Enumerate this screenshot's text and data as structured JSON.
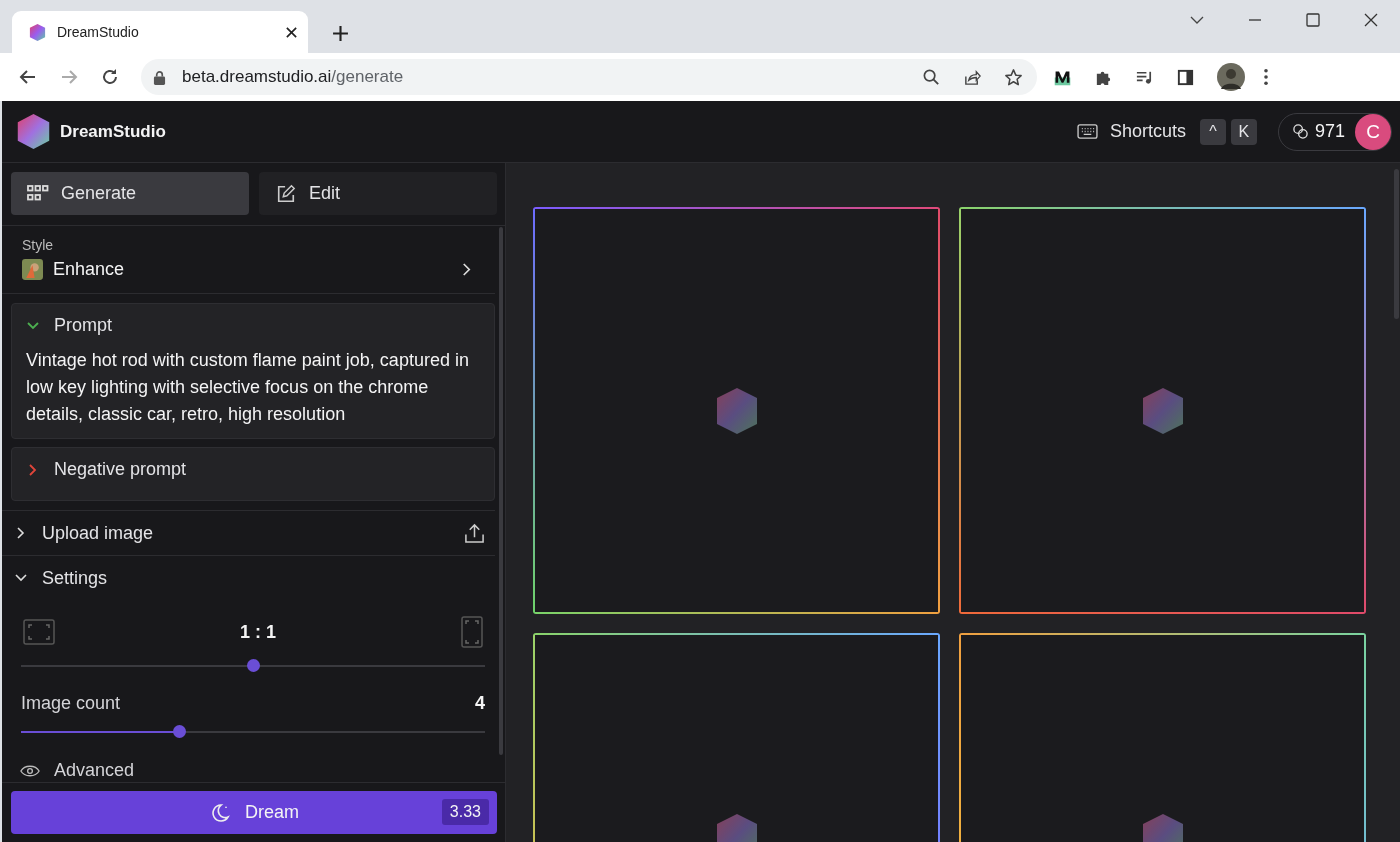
{
  "browser": {
    "tab_title": "DreamStudio",
    "url_host": "beta.dreamstudio.ai",
    "url_path": "/generate"
  },
  "header": {
    "app_name": "DreamStudio",
    "shortcuts_label": "Shortcuts",
    "keys": [
      "^",
      "K"
    ],
    "credits": "971",
    "user_initial": "C"
  },
  "mode_tabs": [
    {
      "label": "Generate",
      "selected": true,
      "kind": "grid"
    },
    {
      "label": "Edit",
      "selected": false,
      "kind": "edit"
    }
  ],
  "style": {
    "label": "Style",
    "value": "Enhance"
  },
  "prompts": [
    {
      "title": "Prompt",
      "expanded": true,
      "color": "#4caf50",
      "text": "Vintage hot rod with custom flame paint job, captured in low key lighting with selective focus on the chrome details, classic car, retro, high resolution"
    },
    {
      "title": "Negative prompt",
      "expanded": false,
      "color": "#e0453a"
    }
  ],
  "upload": {
    "title": "Upload image",
    "expanded": false
  },
  "settings": {
    "title": "Settings",
    "expanded": true,
    "aspect": {
      "label": "1 : 1",
      "level": 0.5
    },
    "image_count": {
      "label": "Image count",
      "value": "4",
      "level": 0.34
    }
  },
  "advanced": {
    "label": "Advanced"
  },
  "dream_button": {
    "label": "Dream",
    "cost": "3.33"
  },
  "images": [
    {
      "kind": "loading"
    },
    {
      "kind": "loading"
    },
    {
      "kind": "loading"
    },
    {
      "kind": "loading"
    }
  ]
}
